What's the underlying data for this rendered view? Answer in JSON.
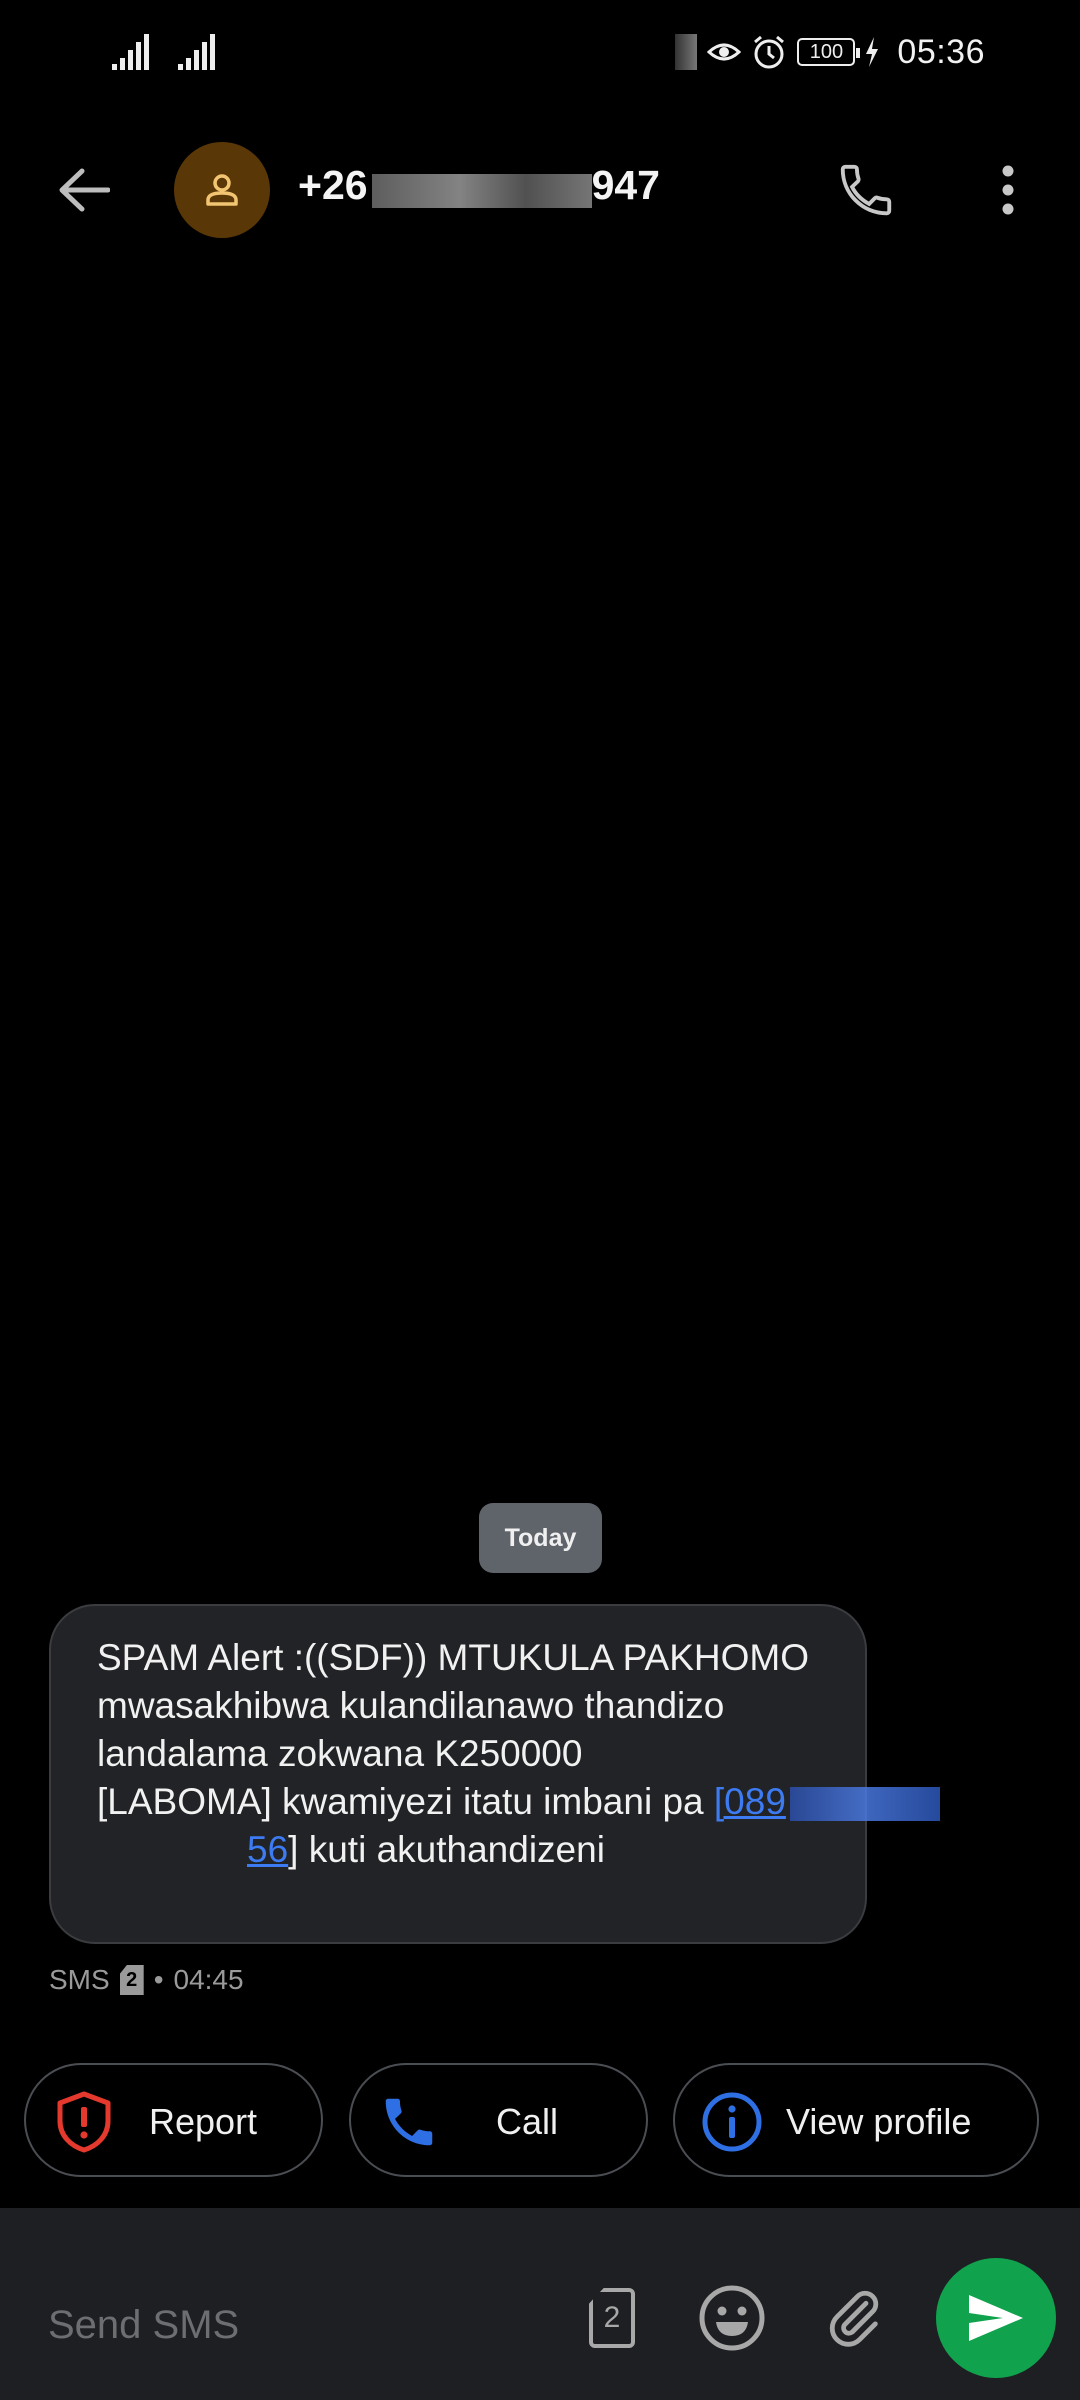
{
  "status_bar": {
    "time": "05:36",
    "battery": "100",
    "icons": [
      "signal-icon",
      "signal-icon",
      "eye-comfort-icon",
      "alarm-icon",
      "battery-icon",
      "charging-icon"
    ]
  },
  "header": {
    "contact_prefix": "+26",
    "contact_suffix": "947",
    "icons": {
      "back": "back-arrow-icon",
      "avatar": "person-icon",
      "call": "phone-icon",
      "more": "more-vert-icon"
    }
  },
  "conversation": {
    "date_chip": "Today",
    "message": {
      "text_main": "SPAM Alert :((SDF)) MTUKULA PAKHOMO mwasakhibwa kulandilanawo thandizo landalama zokwana K250000\n[LABOMA] kwamiyezi itatu imbani pa ",
      "link_prefix": "[089",
      "link_suffix": "56",
      "text_tail": "] kuti akuthandizeni",
      "meta_type": "SMS",
      "sim": "2",
      "meta_sep": "•",
      "time": "04:45"
    }
  },
  "actions": {
    "report": "Report",
    "call": "Call",
    "view_profile": "View profile"
  },
  "composer": {
    "placeholder": "Send SMS",
    "sim": "2"
  },
  "colors": {
    "accent_blue": "#3d7bf2",
    "report_red": "#e5392e",
    "send_green": "#11a24e",
    "avatar_brown": "#5a3706"
  }
}
